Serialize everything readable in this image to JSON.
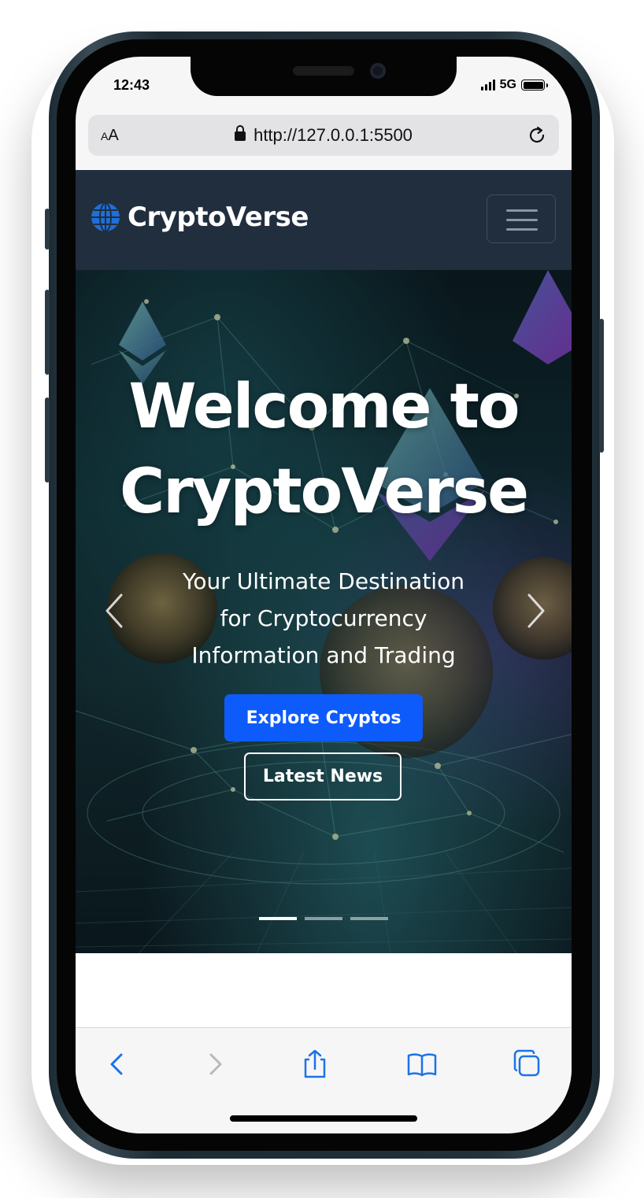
{
  "status_bar": {
    "time": "12:43",
    "network": "5G"
  },
  "browser": {
    "text_size_label": "AA",
    "url": "http://127.0.0.1:5500"
  },
  "nav": {
    "brand": "CryptoVerse"
  },
  "hero": {
    "title_line1": "Welcome to",
    "title_line2": "CryptoVerse",
    "subtitle_line1": "Your Ultimate Destination",
    "subtitle_line2": "for Cryptocurrency",
    "subtitle_line3": "Information and Trading",
    "primary_button": "Explore Cryptos",
    "secondary_button": "Latest News",
    "slide_count": 3,
    "active_slide": 1
  },
  "colors": {
    "nav_bg": "#212e3d",
    "primary": "#0d5bfb",
    "safari_blue": "#1a73e8"
  },
  "icons": [
    "globe-icon",
    "hamburger-icon",
    "lock-icon",
    "reload-icon",
    "chevron-left-icon",
    "chevron-right-icon",
    "share-icon",
    "bookmarks-icon",
    "tabs-icon"
  ]
}
